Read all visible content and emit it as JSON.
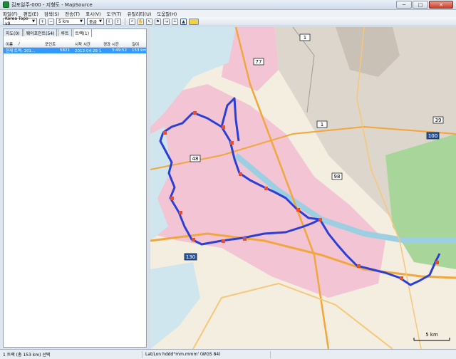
{
  "window": {
    "title": "김포일주-000 - 지형도 - MapSource",
    "minimize": "─",
    "maximize": "□",
    "close": "✕"
  },
  "menu": {
    "items": [
      "파일(F)",
      "편집(E)",
      "검색(S)",
      "전송(T)",
      "표시(V)",
      "도구(T)",
      "유틸리티(U)",
      "도움말(H)"
    ]
  },
  "toolbar": {
    "map_product": "Korea Topo v9",
    "zoom_value": "5 km",
    "detail_value": "중급"
  },
  "left_panel": {
    "tabs": [
      "지도(0)",
      "웨이포인트(54)",
      "루트",
      "트랙(1)"
    ],
    "active_tab_index": 3,
    "columns": [
      "이름",
      "/",
      "포인트",
      "시작 시간",
      "경과 시간",
      "길이"
    ],
    "rows": [
      {
        "name": "현재 트랙: 201...",
        "points": "5821",
        "start_time": "2013-04-28 오전 ...",
        "elapsed": "3:49:52",
        "length": "153 km"
      }
    ]
  },
  "map": {
    "highway_shields": [
      "1",
      "77",
      "48",
      "1",
      "100",
      "39",
      "98",
      "130"
    ],
    "scale_label": "5 km",
    "colors": {
      "urban": "#f2c4d4",
      "water": "#cfe6ee",
      "green": "#a8d59a",
      "terrain": "#ddd6cc",
      "track": "#2b3fd6",
      "major_road": "#f2a63c"
    }
  },
  "status": {
    "selection": "1 트랙 (총 153 km) 선택",
    "coord": "Lat/Lon hddd°mm.mmm' (WGS 84)"
  }
}
